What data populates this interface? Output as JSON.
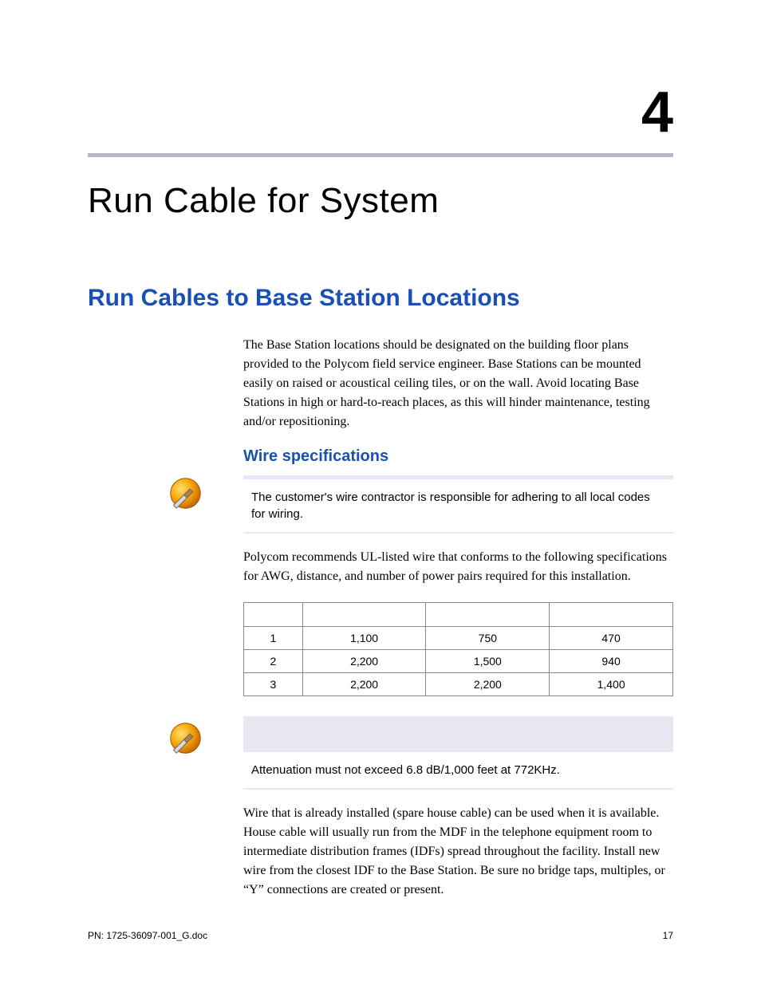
{
  "chapter": {
    "number": "4",
    "title": "Run Cable for System"
  },
  "section": {
    "title": "Run Cables to Base Station Locations",
    "intro": "The Base Station locations should be designated on the building floor plans provided to the Polycom field service engineer. Base Stations can be mounted easily on raised or acoustical ceiling tiles, or on the wall. Avoid locating Base Stations in high or hard-to-reach places, as this will hinder maintenance, testing and/or repositioning."
  },
  "subsection": {
    "title": "Wire specifications",
    "note1": "The customer's wire contractor is responsible for adhering to all local codes for wiring.",
    "recommend": "Polycom recommends UL-listed wire that conforms to the following specifications for AWG, distance, and number of power pairs required for this installation.",
    "note2": "Attenuation must not exceed 6.8 dB/1,000 feet at 772KHz.",
    "closing": "Wire that is already installed (spare house cable) can be used when it is available. House cable will usually run from the MDF in the telephone equipment room to intermediate distribution frames (IDFs) spread throughout the facility. Install new wire from the closest IDF to the Base Station. Be sure no bridge taps, multiples, or “Y” connections are created or present."
  },
  "table": {
    "headers": [
      "",
      "",
      "",
      ""
    ],
    "rows": [
      [
        "1",
        "1,100",
        "750",
        "470"
      ],
      [
        "2",
        "2,200",
        "1,500",
        "940"
      ],
      [
        "3",
        "2,200",
        "2,200",
        "1,400"
      ]
    ]
  },
  "footer": {
    "left": "PN: 1725-36097-001_G.doc",
    "right": "17"
  }
}
